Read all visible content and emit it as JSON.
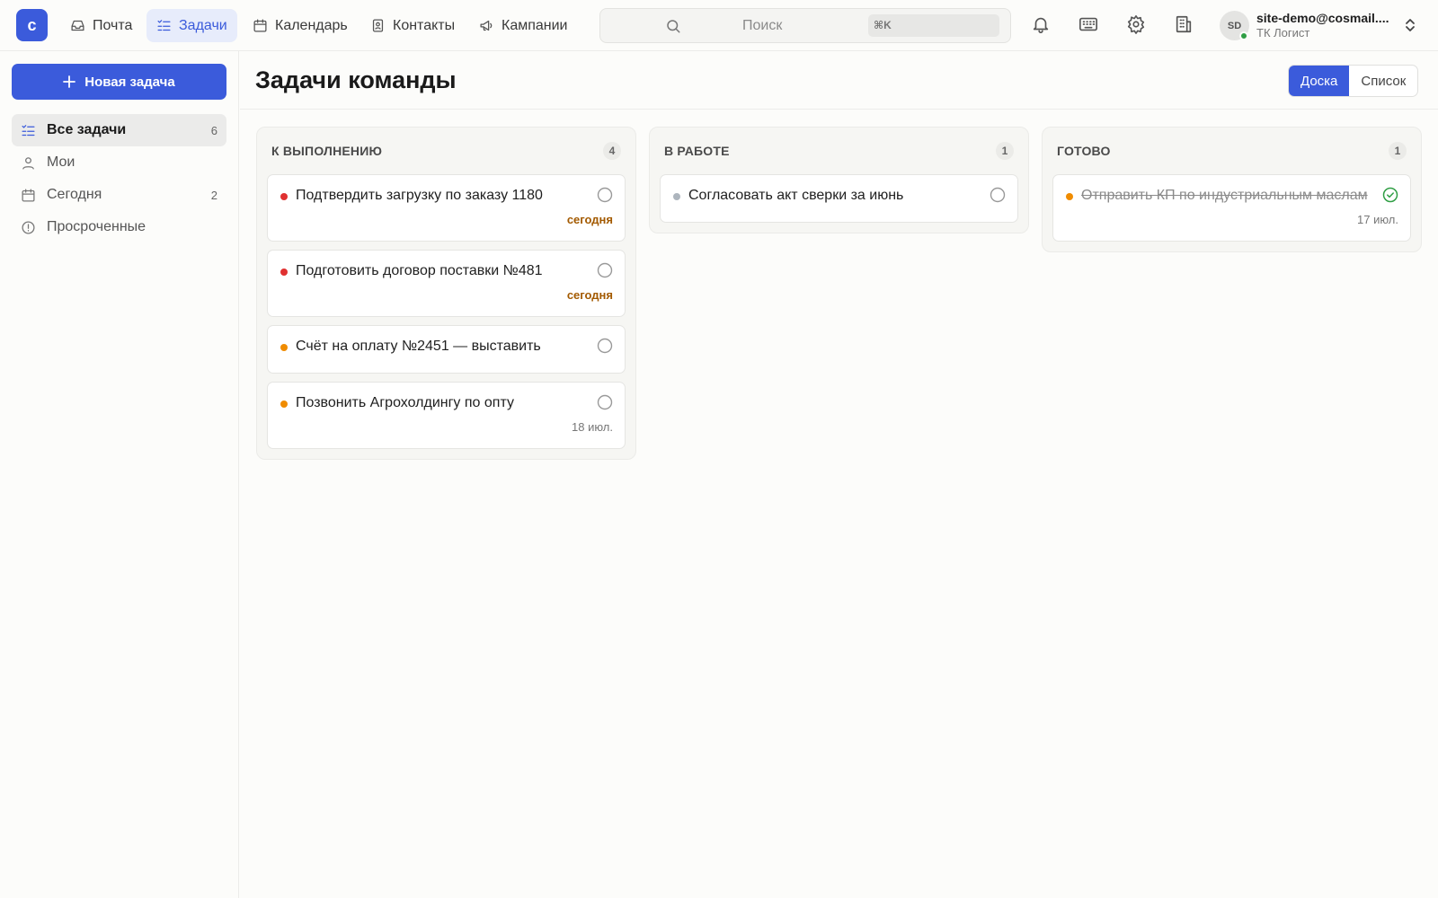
{
  "app": {
    "logo_letter": "c"
  },
  "nav": [
    {
      "label": "Почта",
      "icon": "inbox-icon",
      "active": false
    },
    {
      "label": "Задачи",
      "icon": "tasks-icon",
      "active": true
    },
    {
      "label": "Календарь",
      "icon": "calendar-icon",
      "active": false
    },
    {
      "label": "Контакты",
      "icon": "contacts-icon",
      "active": false
    },
    {
      "label": "Кампании",
      "icon": "megaphone-icon",
      "active": false
    }
  ],
  "search": {
    "placeholder": "Поиск",
    "shortcut": "⌘K"
  },
  "account": {
    "initials": "SD",
    "email": "site-demo@cosmail....",
    "org": "ТК Логист"
  },
  "sidebar": {
    "new_task": "Новая задача",
    "items": [
      {
        "label": "Все задачи",
        "count": "6",
        "icon": "list-icon"
      },
      {
        "label": "Мои",
        "count": "",
        "icon": "user-icon"
      },
      {
        "label": "Сегодня",
        "count": "2",
        "icon": "calendar-icon"
      },
      {
        "label": "Просроченные",
        "count": "",
        "icon": "alert-circle-icon"
      }
    ]
  },
  "main": {
    "title": "Задачи команды",
    "view": {
      "board": "Доска",
      "list": "Список",
      "active": "board"
    }
  },
  "board": {
    "columns": [
      {
        "title": "К ВЫПОЛНЕНИЮ",
        "count": "4",
        "cards": [
          {
            "title": "Подтвердить загрузку по заказу 1180",
            "priority_color": "#e03131",
            "due": "сегодня",
            "due_today": true,
            "done": false
          },
          {
            "title": "Подготовить договор поставки №481",
            "priority_color": "#e03131",
            "due": "сегодня",
            "due_today": true,
            "done": false
          },
          {
            "title": "Счёт на оплату №2451 — выставить",
            "priority_color": "#f08c00",
            "due": "",
            "due_today": false,
            "done": false
          },
          {
            "title": "Позвонить Агрохолдингу по опту",
            "priority_color": "#f08c00",
            "due": "18 июл.",
            "due_today": false,
            "done": false
          }
        ]
      },
      {
        "title": "В РАБОТЕ",
        "count": "1",
        "cards": [
          {
            "title": "Согласовать акт сверки за июнь",
            "priority_color": "#adb5bd",
            "due": "",
            "due_today": false,
            "done": false
          }
        ]
      },
      {
        "title": "ГОТОВО",
        "count": "1",
        "cards": [
          {
            "title": "Отправить КП по индустриальным маслам",
            "priority_color": "#f08c00",
            "due": "17 июл.",
            "due_today": false,
            "done": true
          }
        ]
      }
    ]
  },
  "colors": {
    "accent": "#3b5bdb",
    "high": "#e03131",
    "medium": "#f08c00",
    "low": "#adb5bd",
    "done": "#2f9e44",
    "today": "#a35a00"
  }
}
